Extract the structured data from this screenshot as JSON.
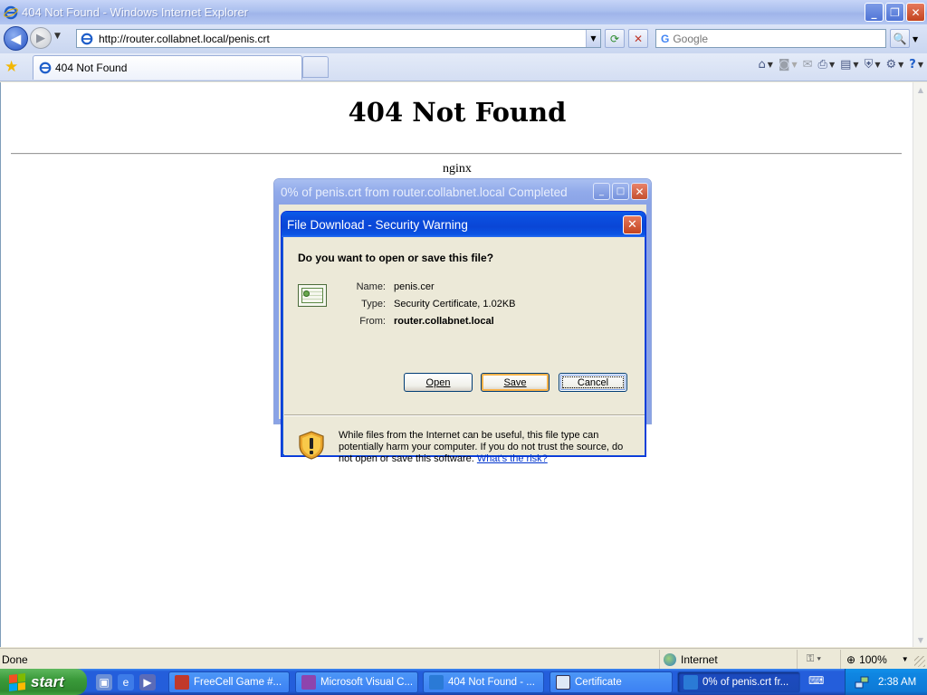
{
  "window": {
    "title": "404 Not Found - Windows Internet Explorer"
  },
  "address_bar": {
    "url": "http://router.collabnet.local/penis.crt"
  },
  "search": {
    "placeholder": "Google"
  },
  "tabs": [
    {
      "label": "404 Not Found"
    }
  ],
  "page": {
    "heading": "404 Not Found",
    "server": "nginx"
  },
  "progress_window": {
    "title": "0% of penis.crt from router.collabnet.local Completed"
  },
  "dialog": {
    "title": "File Download - Security Warning",
    "question": "Do you want to open or save this file?",
    "name_label": "Name:",
    "name_value": "penis.cer",
    "type_label": "Type:",
    "type_value": "Security Certificate, 1.02KB",
    "from_label": "From:",
    "from_value": "router.collabnet.local",
    "open_label": "Open",
    "save_label": "Save",
    "cancel_label": "Cancel",
    "warning_text": "While files from the Internet can be useful, this file type can potentially harm your computer. If you do not trust the source, do not open or save this software.",
    "risk_link": "What's the risk?"
  },
  "status_bar": {
    "status": "Done",
    "zone": "Internet",
    "zoom": "100%"
  },
  "taskbar": {
    "start_label": "start",
    "tasks": [
      {
        "label": "FreeCell Game #...",
        "icon_color": "#c0392b"
      },
      {
        "label": "Microsoft Visual C...",
        "icon_color": "#8e44ad"
      },
      {
        "label": "404 Not Found - ...",
        "icon_color": "#2a7ad6"
      },
      {
        "label": "Certificate",
        "icon_color": "#dfe8f6"
      },
      {
        "label": "0% of penis.crt fr...",
        "icon_color": "#2a7ad6"
      }
    ],
    "clock": "2:38 AM"
  },
  "colors": {
    "xp_blue": "#0b4fe0",
    "start_green": "#3b9a3b",
    "link": "#0033cc"
  }
}
